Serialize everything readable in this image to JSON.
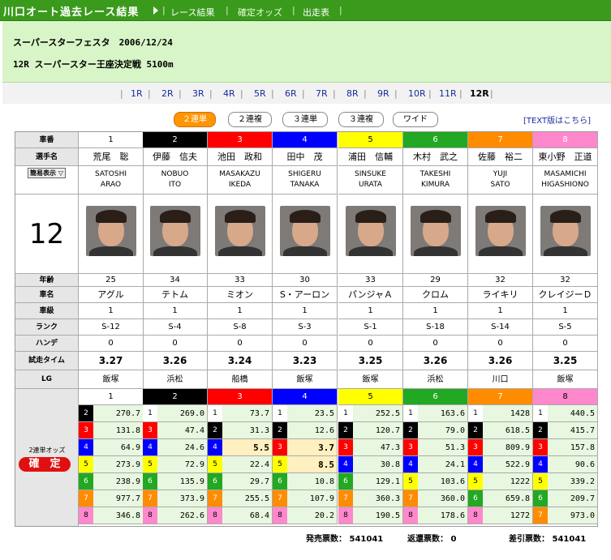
{
  "topbar": {
    "title": "川口オート過去レース結果",
    "nav": [
      "レース結果",
      "確定オッズ",
      "出走表"
    ]
  },
  "header": {
    "line1": "スーパースターフェスタ　2006/12/24",
    "line2": "12R スーパースター王座決定戦 5100m"
  },
  "races": [
    "1R",
    "2R",
    "3R",
    "4R",
    "5R",
    "6R",
    "7R",
    "8R",
    "9R",
    "10R",
    "11R",
    "12R"
  ],
  "current_race": "12R",
  "bet_tabs": [
    "２連単",
    "２連複",
    "３連単",
    "３連複",
    "ワイド"
  ],
  "active_tab": "２連単",
  "text_link": "[TEXT版はこちら]",
  "race_number": "12",
  "display_select": "簡易表示",
  "row_labels": {
    "number": "車番",
    "name": "選手名",
    "age": "年齢",
    "bike": "車名",
    "class": "車級",
    "rank": "ランク",
    "handicap": "ハンデ",
    "trial": "試走タイム",
    "lg": "LG"
  },
  "colors": {
    "1": "#ffffff",
    "2": "#000000",
    "3": "#ff0000",
    "4": "#0000ff",
    "5": "#ffff00",
    "6": "#22a822",
    "7": "#ff8c00",
    "8": "#ff88cc"
  },
  "racers": [
    {
      "no": "1",
      "name": "荒尾　聡",
      "roman1": "SATOSHI",
      "roman2": "ARAO",
      "age": "25",
      "bike": "アグル",
      "class": "1",
      "rank": "S-12",
      "handicap": "0",
      "trial": "3.27",
      "lg": "飯塚"
    },
    {
      "no": "2",
      "name": "伊藤　信夫",
      "roman1": "NOBUO",
      "roman2": "ITO",
      "age": "34",
      "bike": "テトム",
      "class": "1",
      "rank": "S-4",
      "handicap": "0",
      "trial": "3.26",
      "lg": "浜松"
    },
    {
      "no": "3",
      "name": "池田　政和",
      "roman1": "MASAKAZU",
      "roman2": "IKEDA",
      "age": "33",
      "bike": "ミオン",
      "class": "1",
      "rank": "S-8",
      "handicap": "0",
      "trial": "3.24",
      "lg": "船橋"
    },
    {
      "no": "4",
      "name": "田中　茂",
      "roman1": "SHIGERU",
      "roman2": "TANAKA",
      "age": "30",
      "bike": "S・アーロン",
      "class": "1",
      "rank": "S-3",
      "handicap": "0",
      "trial": "3.23",
      "lg": "飯塚"
    },
    {
      "no": "5",
      "name": "浦田　信輔",
      "roman1": "SINSUKE",
      "roman2": "URATA",
      "age": "33",
      "bike": "パンジャＡ",
      "class": "1",
      "rank": "S-1",
      "handicap": "0",
      "trial": "3.25",
      "lg": "飯塚"
    },
    {
      "no": "6",
      "name": "木村　武之",
      "roman1": "TAKESHI",
      "roman2": "KIMURA",
      "age": "29",
      "bike": "クロム",
      "class": "1",
      "rank": "S-18",
      "handicap": "0",
      "trial": "3.26",
      "lg": "浜松"
    },
    {
      "no": "7",
      "name": "佐藤　裕二",
      "roman1": "YUJI",
      "roman2": "SATO",
      "age": "32",
      "bike": "ライキリ",
      "class": "1",
      "rank": "S-14",
      "handicap": "0",
      "trial": "3.26",
      "lg": "川口"
    },
    {
      "no": "8",
      "name": "東小野　正道",
      "roman1": "MASAMICHI",
      "roman2": "HIGASHIONO",
      "age": "32",
      "bike": "クレイジーＤ",
      "class": "1",
      "rank": "S-5",
      "handicap": "0",
      "trial": "3.25",
      "lg": "飯塚"
    }
  ],
  "odds_label": "2連単オッズ",
  "odds_badge": "確　定",
  "odds": [
    [
      [
        "2",
        "270.7"
      ],
      [
        "3",
        "131.8"
      ],
      [
        "4",
        "64.9"
      ],
      [
        "5",
        "273.9"
      ],
      [
        "6",
        "238.9"
      ],
      [
        "7",
        "977.7"
      ],
      [
        "8",
        "346.8"
      ]
    ],
    [
      [
        "1",
        "269.0"
      ],
      [
        "3",
        "47.4"
      ],
      [
        "4",
        "24.6"
      ],
      [
        "5",
        "72.9"
      ],
      [
        "6",
        "135.9"
      ],
      [
        "7",
        "373.9"
      ],
      [
        "8",
        "262.6"
      ]
    ],
    [
      [
        "1",
        "73.7"
      ],
      [
        "2",
        "31.3"
      ],
      [
        "4",
        "5.5"
      ],
      [
        "5",
        "22.4"
      ],
      [
        "6",
        "29.7"
      ],
      [
        "7",
        "255.5"
      ],
      [
        "8",
        "68.4"
      ]
    ],
    [
      [
        "1",
        "23.5"
      ],
      [
        "2",
        "12.6"
      ],
      [
        "3",
        "3.7"
      ],
      [
        "5",
        "8.5"
      ],
      [
        "6",
        "10.8"
      ],
      [
        "7",
        "107.9"
      ],
      [
        "8",
        "20.2"
      ]
    ],
    [
      [
        "1",
        "252.5"
      ],
      [
        "2",
        "120.7"
      ],
      [
        "3",
        "47.3"
      ],
      [
        "4",
        "30.8"
      ],
      [
        "6",
        "129.1"
      ],
      [
        "7",
        "360.3"
      ],
      [
        "8",
        "190.5"
      ]
    ],
    [
      [
        "1",
        "163.6"
      ],
      [
        "2",
        "79.0"
      ],
      [
        "3",
        "51.3"
      ],
      [
        "4",
        "24.1"
      ],
      [
        "5",
        "103.6"
      ],
      [
        "7",
        "360.0"
      ],
      [
        "8",
        "178.6"
      ]
    ],
    [
      [
        "1",
        "1428"
      ],
      [
        "2",
        "618.5"
      ],
      [
        "3",
        "809.9"
      ],
      [
        "4",
        "522.9"
      ],
      [
        "5",
        "1222"
      ],
      [
        "6",
        "659.8"
      ],
      [
        "8",
        "1272"
      ]
    ],
    [
      [
        "1",
        "440.5"
      ],
      [
        "2",
        "415.7"
      ],
      [
        "3",
        "157.8"
      ],
      [
        "4",
        "90.6"
      ],
      [
        "5",
        "339.2"
      ],
      [
        "6",
        "209.7"
      ],
      [
        "7",
        "973.0"
      ]
    ]
  ],
  "footer": {
    "sold": "発売票数： 541041",
    "refund": "返還票数： 0",
    "net": "差引票数： 541041"
  }
}
